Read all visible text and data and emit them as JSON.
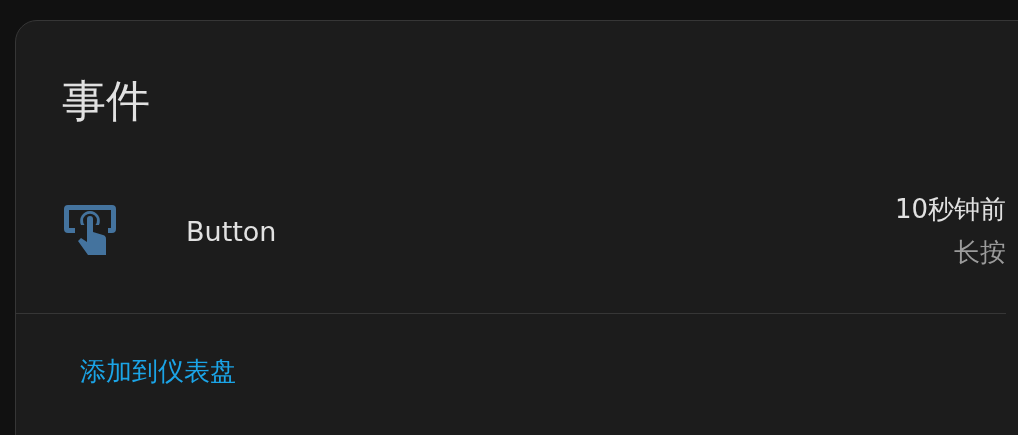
{
  "card": {
    "title": "事件"
  },
  "entity": {
    "name": "Button",
    "time": "10秒钟前",
    "state": "长按"
  },
  "footer": {
    "link": "添加到仪表盘"
  }
}
